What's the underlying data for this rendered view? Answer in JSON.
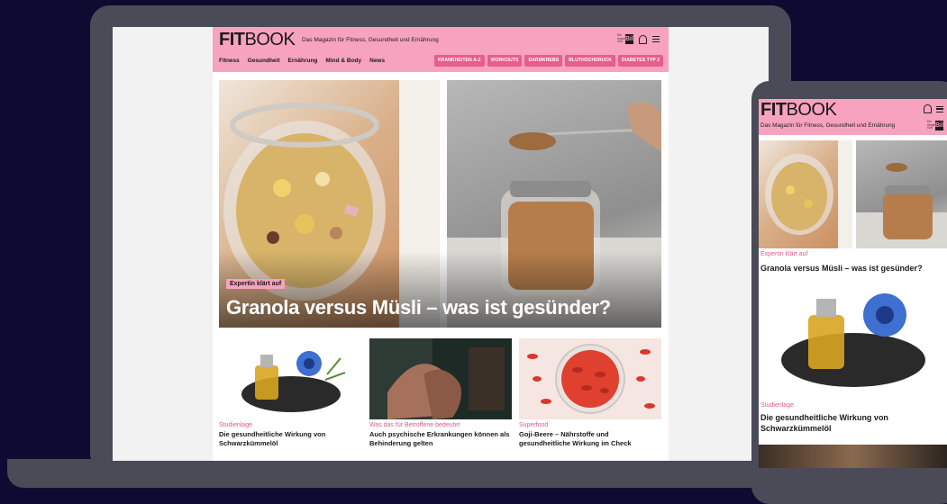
{
  "brand": {
    "logo_bold": "FIT",
    "logo_light": "BOOK",
    "tagline": "Das Magazin für Fitness, Gesundheit und Ernährung",
    "partner_small": "Ein Angebot von",
    "partner": "Bild",
    "pink": "#f7a2be",
    "accent": "#e85d8a"
  },
  "nav": {
    "items": [
      "Fitness",
      "Gesundheit",
      "Ernährung",
      "Mind & Body",
      "News"
    ],
    "pills": [
      "KRANKHEITEN A-Z",
      "WORKOUTS",
      "DARMKREBS",
      "BLUTHOCHDRUCK",
      "DIABETES TYP 2"
    ]
  },
  "hero": {
    "kicker": "Expertin klärt auf",
    "title": "Granola versus Müsli – was ist gesünder?"
  },
  "teasers": [
    {
      "kicker": "Studienlage",
      "title": "Die gesundheitliche Wirkung von Schwarzkümmelöl"
    },
    {
      "kicker": "Was das für Betroffene bedeutet",
      "title": "Auch psychische Erkrankungen können als Behinderung gelten"
    },
    {
      "kicker": "Superfood",
      "title": "Goji-Beere – Nährstoffe und gesundheitliche Wirkung im Check"
    }
  ],
  "mobile": {
    "kicker1": "Expertin klärt auf",
    "title1": "Granola versus Müsli – was ist gesünder?",
    "kicker2": "Studienlage",
    "title2": "Die gesundheitliche Wirkung von Schwarzkümmelöl"
  },
  "icons": {
    "bell": "bell-icon",
    "menu": "menu-icon"
  }
}
